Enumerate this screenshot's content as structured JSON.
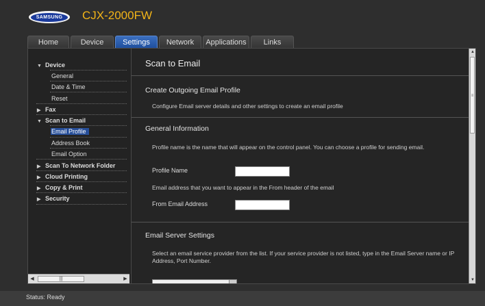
{
  "brand": "SAMSUNG",
  "model": "CJX-2000FW",
  "tabs": [
    {
      "label": "Home"
    },
    {
      "label": "Device"
    },
    {
      "label": "Settings"
    },
    {
      "label": "Network"
    },
    {
      "label": "Applications"
    },
    {
      "label": "Links"
    }
  ],
  "active_tab": "Settings",
  "sidebar": {
    "device": "Device",
    "general": "General",
    "date_time": "Date & Time",
    "reset": "Reset",
    "fax": "Fax",
    "scan_to_email": "Scan to Email",
    "email_profile": "Email Profile",
    "address_book": "Address Book",
    "email_option": "Email Option",
    "scan_to_network_folder": "Scan To Network Folder",
    "cloud_printing": "Cloud Printing",
    "copy_print": "Copy & Print",
    "security": "Security"
  },
  "main": {
    "page_title": "Scan to Email",
    "create_profile_title": "Create Outgoing Email Profile",
    "create_profile_desc": "Configure Email server details and other settings to create an email profile",
    "general_info_title": "General Information",
    "general_info_desc": "Profile name is the name that will appear on the control panel. You can choose a profile for sending email.",
    "profile_name_label": "Profile Name",
    "profile_name_value": "",
    "from_desc": "Email address that you want to appear in the From header of the email",
    "from_email_label": "From Email Address",
    "from_email_value": "",
    "server_settings_title": "Email Server Settings",
    "server_settings_desc": "Select an email service provider from the list. If your service provider is not listed, type in the Email Server name or IP Address, Port Number."
  },
  "status": "Status: Ready",
  "colors": {
    "accent": "#f2b418",
    "active_tab": "#2a5aab",
    "selected_item": "#274f9a",
    "background": "#2e2e2e"
  }
}
